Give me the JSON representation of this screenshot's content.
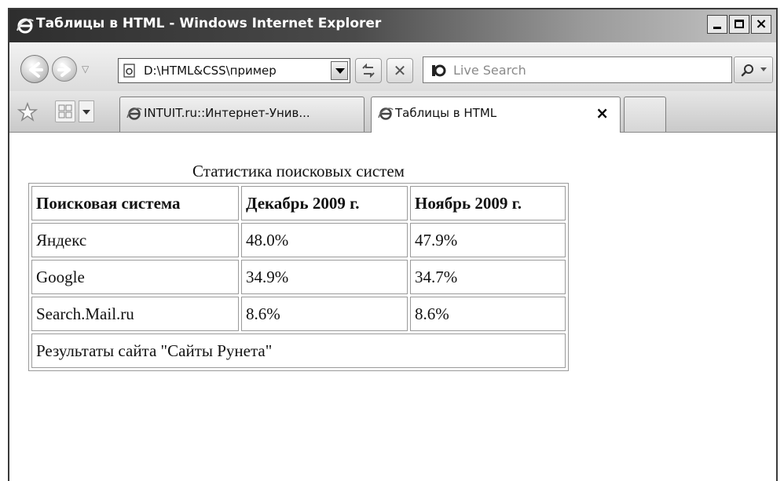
{
  "window": {
    "title": "Таблицы в HTML - Windows Internet Explorer",
    "controls": {
      "minimize": "_",
      "maximize": "□",
      "close": "×"
    }
  },
  "navbar": {
    "address": "D:\\HTML&CSS\\пример",
    "search_placeholder": "Live Search"
  },
  "tabs": [
    {
      "label": "INTUIT.ru::Интернет-Унив...",
      "active": false
    },
    {
      "label": "Таблицы в HTML",
      "active": true,
      "close": "×"
    }
  ],
  "page": {
    "caption": "Статистика поисковых систем",
    "headers": [
      "Поисковая система",
      "Декабрь 2009 г.",
      "Ноябрь 2009 г."
    ],
    "rows": [
      [
        "Яндекс",
        "48.0%",
        "47.9%"
      ],
      [
        "Google",
        "34.9%",
        "34.7%"
      ],
      [
        "Search.Mail.ru",
        "8.6%",
        "8.6%"
      ]
    ],
    "footer": "Результаты сайта \"Сайты Рунета\""
  },
  "colors": {
    "titlebar_dark": "#2e2e2e",
    "border": "#9a9a9a",
    "text": "#111111"
  },
  "icons": [
    "ie-logo-icon",
    "back-arrow-icon",
    "forward-arrow-icon",
    "page-icon",
    "refresh-icon",
    "stop-icon",
    "live-search-icon",
    "magnifier-icon",
    "favorites-star-icon",
    "quick-tabs-icon"
  ]
}
